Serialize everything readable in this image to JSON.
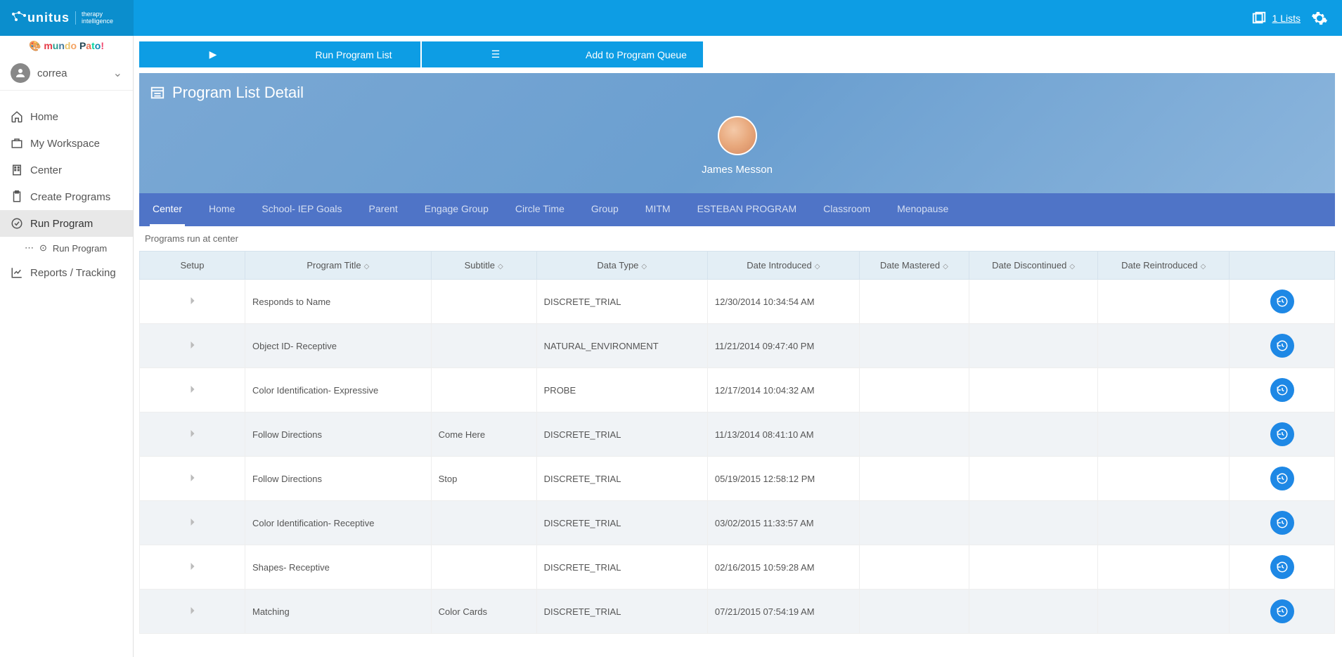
{
  "brand": {
    "name": "unitus",
    "sub1": "therapy",
    "sub2": "intelligence"
  },
  "org_logo_text": "mundo Pato!",
  "topbar": {
    "lists_label": "1 Lists"
  },
  "user": {
    "name": "correa"
  },
  "sidebar": {
    "items": [
      {
        "label": "Home",
        "icon": "home"
      },
      {
        "label": "My Workspace",
        "icon": "briefcase"
      },
      {
        "label": "Center",
        "icon": "building"
      },
      {
        "label": "Create Programs",
        "icon": "clipboard"
      },
      {
        "label": "Run Program",
        "icon": "check-circle",
        "active": true
      },
      {
        "label": "Reports / Tracking",
        "icon": "chart"
      }
    ],
    "sub": {
      "label": "Run Program"
    }
  },
  "actions": {
    "run": "Run Program List",
    "queue": "Add to Program Queue"
  },
  "panel": {
    "title": "Program List Detail"
  },
  "client": {
    "name": "James Messon"
  },
  "tabs": [
    "Center",
    "Home",
    "School- IEP Goals",
    "Parent",
    "Engage Group",
    "Circle Time",
    "Group",
    "MITM",
    "ESTEBAN PROGRAM",
    "Classroom",
    "Menopause"
  ],
  "active_tab": 0,
  "section_label": "Programs run at center",
  "columns": [
    "Setup",
    "Program Title",
    "Subtitle",
    "Data Type",
    "Date Introduced",
    "Date Mastered",
    "Date Discontinued",
    "Date Reintroduced",
    ""
  ],
  "rows": [
    {
      "title": "Responds to Name",
      "subtitle": "",
      "data_type": "DISCRETE_TRIAL",
      "introduced": "12/30/2014 10:34:54 AM",
      "mastered": "",
      "discontinued": "",
      "reintroduced": ""
    },
    {
      "title": "Object ID- Receptive",
      "subtitle": "",
      "data_type": "NATURAL_ENVIRONMENT",
      "introduced": "11/21/2014 09:47:40 PM",
      "mastered": "",
      "discontinued": "",
      "reintroduced": ""
    },
    {
      "title": "Color Identification- Expressive",
      "subtitle": "",
      "data_type": "PROBE",
      "introduced": "12/17/2014 10:04:32 AM",
      "mastered": "",
      "discontinued": "",
      "reintroduced": ""
    },
    {
      "title": "Follow Directions",
      "subtitle": "Come Here",
      "data_type": "DISCRETE_TRIAL",
      "introduced": "11/13/2014 08:41:10 AM",
      "mastered": "",
      "discontinued": "",
      "reintroduced": ""
    },
    {
      "title": "Follow Directions",
      "subtitle": "Stop",
      "data_type": "DISCRETE_TRIAL",
      "introduced": "05/19/2015 12:58:12 PM",
      "mastered": "",
      "discontinued": "",
      "reintroduced": ""
    },
    {
      "title": "Color Identification- Receptive",
      "subtitle": "",
      "data_type": "DISCRETE_TRIAL",
      "introduced": "03/02/2015 11:33:57 AM",
      "mastered": "",
      "discontinued": "",
      "reintroduced": ""
    },
    {
      "title": "Shapes- Receptive",
      "subtitle": "",
      "data_type": "DISCRETE_TRIAL",
      "introduced": "02/16/2015 10:59:28 AM",
      "mastered": "",
      "discontinued": "",
      "reintroduced": ""
    },
    {
      "title": "Matching",
      "subtitle": "Color Cards",
      "data_type": "DISCRETE_TRIAL",
      "introduced": "07/21/2015 07:54:19 AM",
      "mastered": "",
      "discontinued": "",
      "reintroduced": ""
    }
  ]
}
